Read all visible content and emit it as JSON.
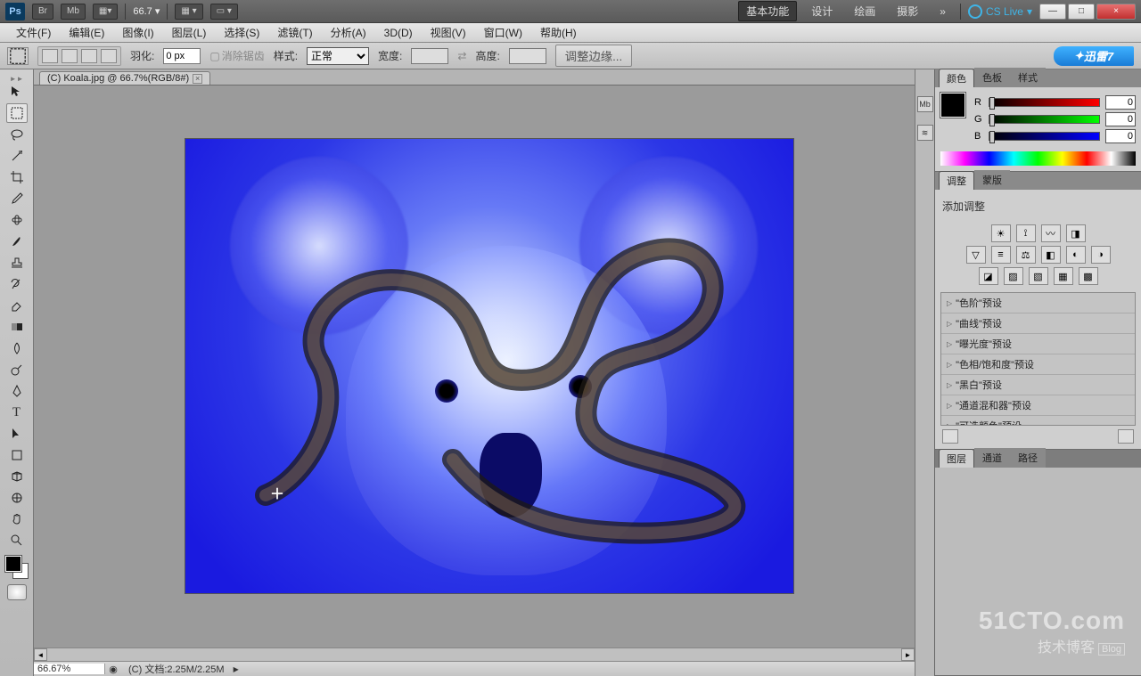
{
  "titlebar": {
    "logo": "Ps",
    "btns": [
      "Br",
      "Mb"
    ],
    "zoom": "66.7",
    "workspaces": [
      "基本功能",
      "设计",
      "绘画",
      "摄影"
    ],
    "more": "»",
    "cslive": "CS Live",
    "win": {
      "min": "—",
      "max": "□",
      "close": "×"
    }
  },
  "menubar": [
    "文件(F)",
    "编辑(E)",
    "图像(I)",
    "图层(L)",
    "选择(S)",
    "滤镜(T)",
    "分析(A)",
    "3D(D)",
    "视图(V)",
    "窗口(W)",
    "帮助(H)"
  ],
  "options": {
    "feather_label": "羽化:",
    "feather_value": "0 px",
    "antialias": "消除锯齿",
    "style_label": "样式:",
    "style_value": "正常",
    "width_label": "宽度:",
    "height_label": "高度:",
    "refine": "调整边缘...",
    "xunlei": "迅雷7"
  },
  "document": {
    "tab": "(C) Koala.jpg @ 66.7%(RGB/8#)",
    "status_zoom": "66.67%",
    "status_doc": "(C) 文档:2.25M/2.25M"
  },
  "dock": {
    "icons": [
      "Mb",
      "≋"
    ]
  },
  "panels": {
    "color": {
      "tabs": [
        "颜色",
        "色板",
        "样式"
      ],
      "r": "0",
      "g": "0",
      "b": "0",
      "labels": {
        "r": "R",
        "g": "G",
        "b": "B"
      }
    },
    "adjust": {
      "tabs": [
        "调整",
        "蒙版"
      ],
      "hint": "添加调整",
      "presets": [
        "\"色阶\"预设",
        "\"曲线\"预设",
        "\"曝光度\"预设",
        "\"色相/饱和度\"预设",
        "\"黑白\"预设",
        "\"通道混和器\"预设",
        "\"可选颜色\"预设"
      ]
    },
    "layers": {
      "tabs": [
        "图层",
        "通道",
        "路径"
      ]
    }
  },
  "watermark": {
    "l1": "51CTO.com",
    "l2": "技术博客",
    "blog": "Blog"
  }
}
